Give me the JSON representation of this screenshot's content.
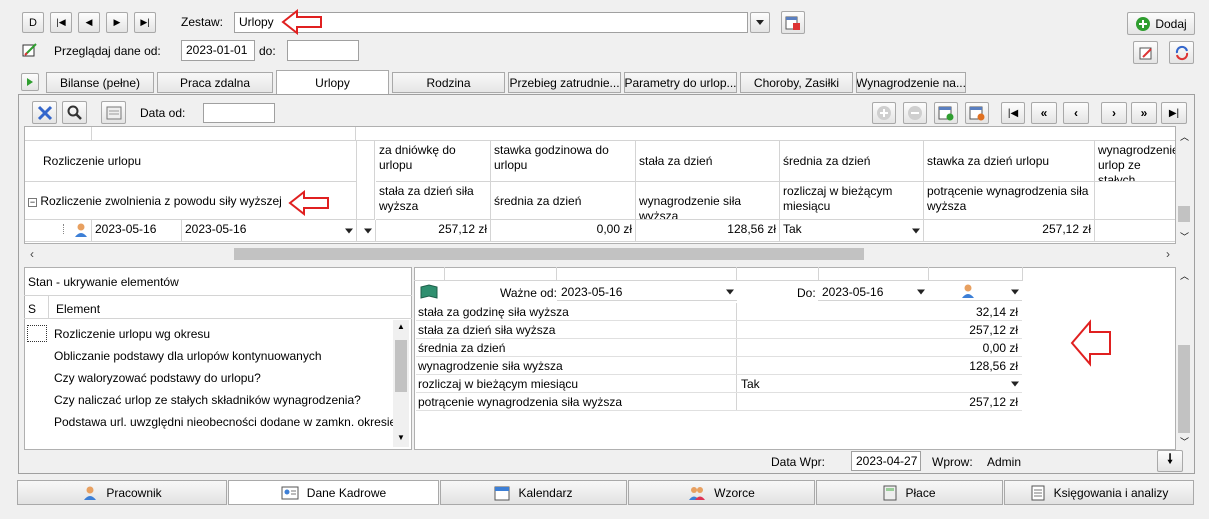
{
  "nav": {
    "first": "D",
    "prev_first": "|◀",
    "prev": "◀",
    "next": "▶",
    "last": "▶|"
  },
  "zestaw": {
    "label": "Zestaw:",
    "value": "Urlopy"
  },
  "przegladaj": {
    "label": "Przeglądaj dane od:",
    "from": "2023-01-01",
    "to_label": "do:",
    "to": ""
  },
  "dodaj": "Dodaj",
  "tabs": [
    "Bilanse (pełne)",
    "Praca zdalna",
    "Urlopy",
    "Rodzina",
    "Przebieg zatrudnie...",
    "Parametry do urlop...",
    "Choroby, Zasiłki",
    "Wynagrodzenie na..."
  ],
  "data_od": {
    "label": "Data od:",
    "value": ""
  },
  "grid": {
    "row_header_1": "Rozliczenie urlopu",
    "row_header_2": "Rozliczenie zwolnienia z powodu siły wyższej",
    "col_headers_top": [
      "za dniówkę do urlopu",
      "stawka godzinowa do urlopu",
      "stała za dzień",
      "średnia za dzień",
      "stawka za dzień urlopu",
      "wynagrodzenie urlop ze stałych"
    ],
    "col_headers_bottom": [
      "stała za dzień siła wyższa",
      "średnia za dzień",
      "wynagrodzenie siła wyższa",
      "rozliczaj w bieżącym miesiącu",
      "potrącenie wynagrodzenia siła wyższa",
      ""
    ],
    "row": {
      "date_from": "2023-05-16",
      "date_to": "2023-05-16",
      "values": [
        "257,12 zł",
        "0,00 zł",
        "128,56 zł",
        "Tak",
        "257,12 zł",
        ""
      ]
    }
  },
  "stan": {
    "title": "Stan - ukrywanie elementów",
    "col_s": "S",
    "col_element": "Element",
    "items": [
      "Rozliczenie urlopu wg okresu",
      "Obliczanie podstawy dla urlopów kontynuowanych",
      "Czy waloryzować podstawy do urlopu?",
      "Czy naliczać urlop ze stałych składników wynagrodzenia?",
      "Podstawa url. uwzględni nieobecności dodane w zamkn. okresie"
    ]
  },
  "detail": {
    "wazne_od_label": "Ważne od:",
    "wazne_od": "2023-05-16",
    "do_label": "Do:",
    "do": "2023-05-16",
    "rows": [
      {
        "k": "stała za godzinę siła wyższa",
        "v": "32,14 zł"
      },
      {
        "k": "stała za dzień siła wyższa",
        "v": "257,12 zł"
      },
      {
        "k": "średnia za dzień",
        "v": "0,00 zł"
      },
      {
        "k": "wynagrodzenie siła wyższa",
        "v": "128,56 zł"
      },
      {
        "k": "rozliczaj w bieżącym miesiącu",
        "v": "Tak"
      },
      {
        "k": "potrącenie wynagrodzenia siła wyższa",
        "v": "257,12 zł"
      }
    ]
  },
  "footer": {
    "data_wpr_label": "Data Wpr:",
    "data_wpr": "2023-04-27",
    "wprow_label": "Wprow:",
    "wprow": "Admin"
  },
  "bottom_tabs": [
    "Pracownik",
    "Dane Kadrowe",
    "Kalendarz",
    "Wzorce",
    "Płace",
    "Księgowania i analizy"
  ],
  "colors": {
    "annotation_red": "#e02020",
    "accent_green": "#2f9e2f"
  }
}
